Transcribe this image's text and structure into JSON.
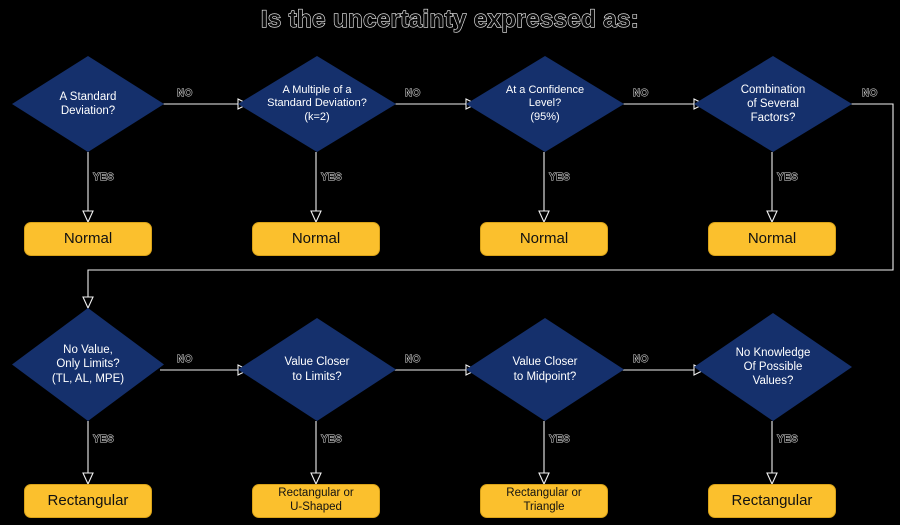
{
  "page": {
    "title": "Is the uncertainty expressed as:",
    "background_color": "#000000",
    "diamond_color": "#15306c",
    "result_color": "#fbc02d",
    "result_border_color": "#d9a218",
    "line_color": "#f0f0f0",
    "diamond_text_color": "#ffffff",
    "result_text_color": "#111111"
  },
  "edges": {
    "no": "NO",
    "yes": "YES"
  },
  "row1": {
    "decisions": [
      {
        "id": "standard-deviation",
        "text": "A Standard\nDeviation?"
      },
      {
        "id": "multiple-standard-deviation",
        "text": "A Multiple of a\nStandard Deviation?\n(k=2)"
      },
      {
        "id": "confidence-level",
        "text": "At a Confidence\nLevel?\n(95%)"
      },
      {
        "id": "combination-of-factors",
        "text": "Combination\nof Several\nFactors?"
      }
    ],
    "results": [
      {
        "id": "normal-1",
        "text": "Normal"
      },
      {
        "id": "normal-2",
        "text": "Normal"
      },
      {
        "id": "normal-3",
        "text": "Normal"
      },
      {
        "id": "normal-4",
        "text": "Normal"
      }
    ]
  },
  "row2": {
    "decisions": [
      {
        "id": "no-value-only-limits",
        "text": "No Value,\nOnly Limits?\n(TL, AL, MPE)"
      },
      {
        "id": "value-closer-limits",
        "text": "Value Closer\nto Limits?"
      },
      {
        "id": "value-closer-midpoint",
        "text": "Value Closer\nto Midpoint?"
      },
      {
        "id": "no-knowledge",
        "text": "No Knowledge\nOf Possible\nValues?"
      }
    ],
    "results": [
      {
        "id": "rectangular-1",
        "text": "Rectangular"
      },
      {
        "id": "rectangular-or-u-shaped",
        "text": "Rectangular or\nU-Shaped"
      },
      {
        "id": "rectangular-or-triangle",
        "text": "Rectangular or\nTriangle"
      },
      {
        "id": "rectangular-2",
        "text": "Rectangular"
      }
    ]
  },
  "edge_labels": {
    "r1_no_1": "NO",
    "r1_no_2": "NO",
    "r1_no_3": "NO",
    "r1_no_4": "NO",
    "r1_yes_1": "YES",
    "r1_yes_2": "YES",
    "r1_yes_3": "YES",
    "r1_yes_4": "YES",
    "r2_no_1": "NO",
    "r2_no_2": "NO",
    "r2_no_3": "NO",
    "r2_yes_1": "YES",
    "r2_yes_2": "YES",
    "r2_yes_3": "YES",
    "r2_yes_4": "YES"
  }
}
